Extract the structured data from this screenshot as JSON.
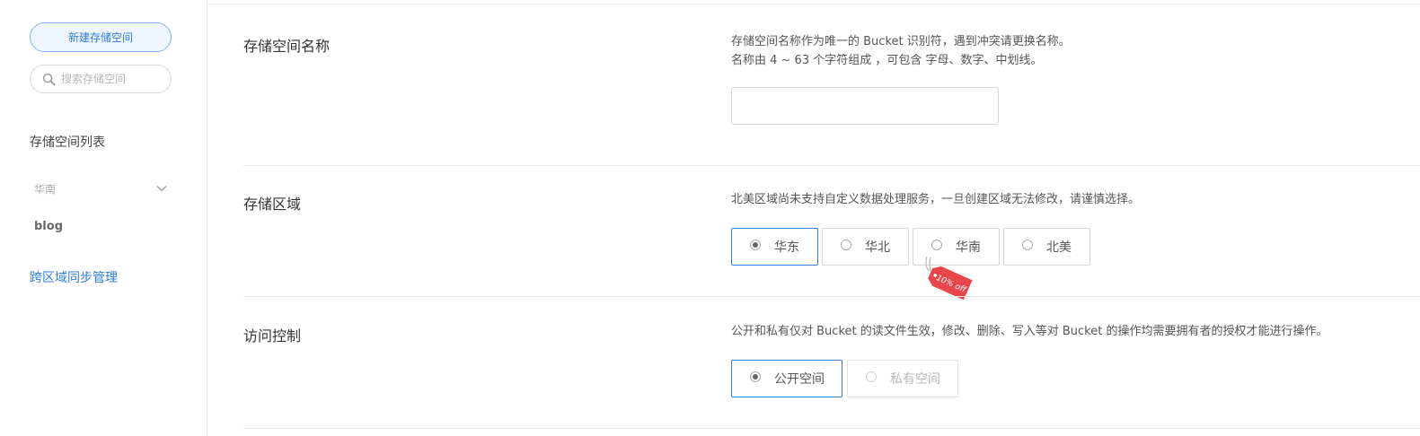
{
  "sidebar": {
    "new_bucket_label": "新建存储空间",
    "search_placeholder": "搜索存储空间",
    "list_title": "存储空间列表",
    "region_filter": "华南",
    "buckets": [
      "blog"
    ],
    "sync_link": "跨区域同步管理"
  },
  "form": {
    "name": {
      "label": "存储空间名称",
      "desc_line1": "存储空间名称作为唯一的 Bucket 识别符，遇到冲突请更换名称。",
      "desc_line2": "名称由 4 ~ 63 个字符组成 ，可包含 字母、数字、中划线。",
      "value": ""
    },
    "region": {
      "label": "存储区域",
      "desc": "北美区域尚未支持自定义数据处理服务，一旦创建区域无法修改，请谨慎选择。",
      "options": [
        "华东",
        "华北",
        "华南",
        "北美"
      ],
      "selected": "华东",
      "promo_tag": "10% off"
    },
    "access": {
      "label": "访问控制",
      "desc": "公开和私有仅对 Bucket 的读文件生效，修改、删除、写入等对 Bucket 的操作均需要拥有者的授权才能进行操作。",
      "options": [
        "公开空间",
        "私有空间"
      ],
      "selected": "公开空间",
      "disabled": [
        "私有空间"
      ]
    }
  },
  "colors": {
    "accent": "#2f7ed8",
    "tag": "#e8464b"
  }
}
